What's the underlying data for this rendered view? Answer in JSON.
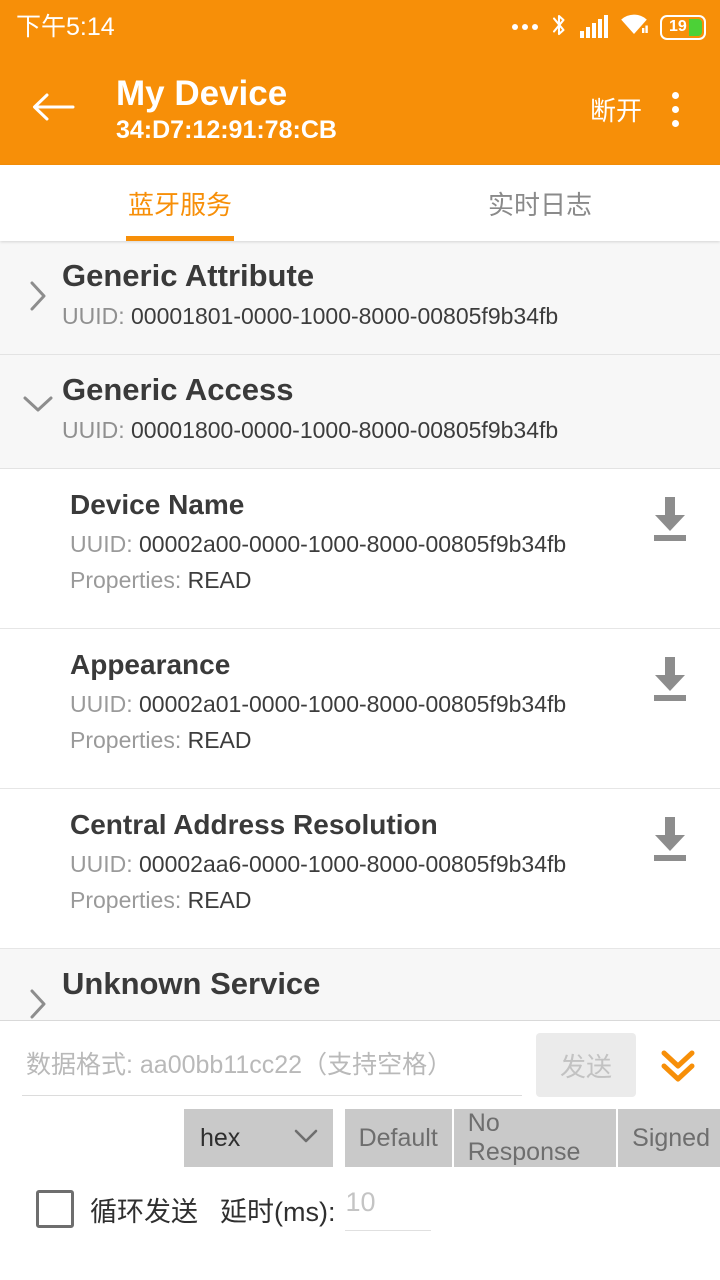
{
  "statusbar": {
    "time": "下午5:14",
    "icons": [
      "ellipsis-icon",
      "bluetooth-icon",
      "cellular-signal-icon",
      "wifi-icon",
      "battery-icon"
    ],
    "battery_level": "19"
  },
  "appbar": {
    "back_icon": "arrow-left-icon",
    "title": "My Device",
    "subtitle": "34:D7:12:91:78:CB",
    "action_label": "断开",
    "overflow_icon": "more-vertical-icon",
    "background_color": "#F78F08"
  },
  "tabs": [
    {
      "label": "蓝牙服务",
      "active": true
    },
    {
      "label": "实时日志",
      "active": false
    }
  ],
  "labels": {
    "uuid_prefix": "UUID: ",
    "properties_prefix": "Properties: "
  },
  "services": [
    {
      "name": "Generic Attribute",
      "uuid": "00001801-0000-1000-8000-00805f9b34fb",
      "expanded": false,
      "chevron": "chevron-right-icon"
    },
    {
      "name": "Generic Access",
      "uuid": "00001800-0000-1000-8000-00805f9b34fb",
      "expanded": true,
      "chevron": "chevron-down-icon"
    },
    {
      "name": "Unknown Service",
      "uuid": "",
      "expanded": false,
      "chevron": "chevron-right-icon"
    }
  ],
  "characteristics": [
    {
      "name": "Device Name",
      "uuid": "00002a00-0000-1000-8000-00805f9b34fb",
      "properties": "READ",
      "action_icon": "download-icon"
    },
    {
      "name": "Appearance",
      "uuid": "00002a01-0000-1000-8000-00805f9b34fb",
      "properties": "READ",
      "action_icon": "download-icon"
    },
    {
      "name": "Central Address Resolution",
      "uuid": "00002aa6-0000-1000-8000-00805f9b34fb",
      "properties": "READ",
      "action_icon": "download-icon"
    }
  ],
  "bottom_panel": {
    "data_input": {
      "value": "",
      "placeholder": "数据格式: aa00bb11cc22（支持空格）"
    },
    "send_button": {
      "label": "发送",
      "enabled": false
    },
    "expand_icon": "chevrons-down-icon",
    "format_spinner": {
      "value": "hex",
      "chevron": "chevron-down-icon"
    },
    "write_modes": [
      "Default",
      "No Response",
      "Signed"
    ],
    "loop_checkbox": {
      "label": "循环发送",
      "checked": false
    },
    "delay": {
      "label": "延时(ms):",
      "value": "",
      "placeholder": "10"
    }
  },
  "colors": {
    "accent": "#F78F08",
    "battery_fill": "#4CD137",
    "service_bg": "#F7F7F7"
  }
}
